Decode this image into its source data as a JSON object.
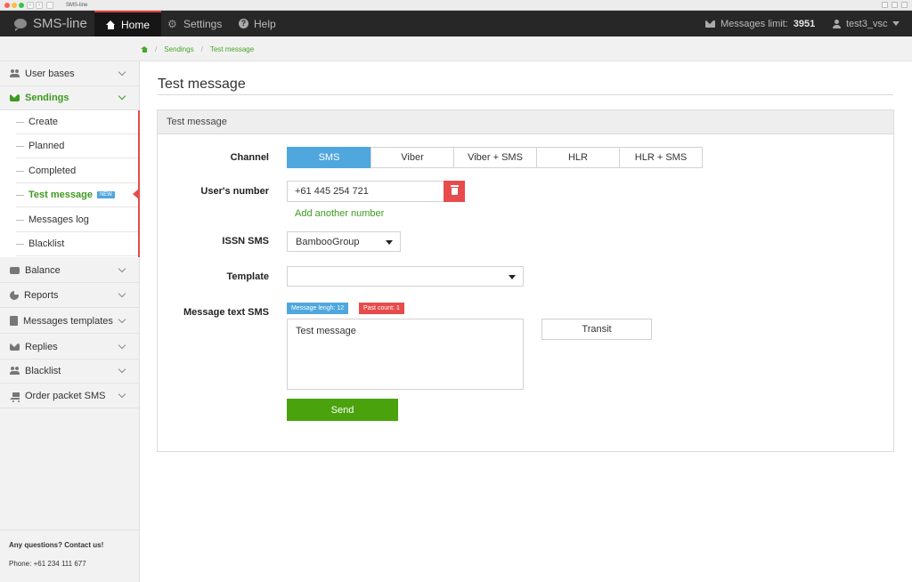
{
  "browser": {
    "tab_title": "SMS-line"
  },
  "topnav": {
    "brand": "SMS-line",
    "items": [
      {
        "label": "Home",
        "icon": "home-icon",
        "active": true
      },
      {
        "label": "Settings",
        "icon": "gear-icon"
      },
      {
        "label": "Help",
        "icon": "help-icon"
      }
    ],
    "limit_label": "Messages limit:",
    "limit_value": "3951",
    "user": "test3_vsc"
  },
  "breadcrumb": [
    "Sendings",
    "Test message"
  ],
  "sidebar": {
    "items": [
      {
        "label": "User bases",
        "icon": "users-icon"
      },
      {
        "label": "Sendings",
        "icon": "envelope-icon",
        "open": true
      },
      {
        "label": "Balance",
        "icon": "wallet-icon"
      },
      {
        "label": "Reports",
        "icon": "pie-chart-icon"
      },
      {
        "label": "Messages templates",
        "icon": "document-icon"
      },
      {
        "label": "Replies",
        "icon": "envelope-icon"
      },
      {
        "label": "Blacklist",
        "icon": "users-icon"
      },
      {
        "label": "Order packet SMS",
        "icon": "cart-icon"
      }
    ],
    "sub_items": [
      {
        "label": "Create"
      },
      {
        "label": "Planned"
      },
      {
        "label": "Completed"
      },
      {
        "label": "Test message",
        "active": true,
        "badge": "NEW"
      },
      {
        "label": "Messages log"
      },
      {
        "label": "Blacklist"
      }
    ],
    "contact": {
      "question": "Any questions? Contact us!",
      "phone": "Phone: +61 234 111 677"
    }
  },
  "main": {
    "title": "Test message",
    "panel_title": "Test message",
    "channel": {
      "label": "Channel",
      "options": [
        "SMS",
        "Viber",
        "Viber + SMS",
        "HLR",
        "HLR + SMS"
      ],
      "selected": "SMS"
    },
    "users_number": {
      "label": "User's number",
      "value": "+61 445 254 721",
      "add_link": "Add another number"
    },
    "issn": {
      "label": "ISSN SMS",
      "value": "BambooGroup"
    },
    "template": {
      "label": "Template",
      "value": ""
    },
    "message": {
      "label": "Message text SMS",
      "length_badge": "Message lengh: 12",
      "count_badge": "Past count: 1",
      "text": "Test message",
      "transit_label": "Transit"
    },
    "send_label": "Send"
  },
  "colors": {
    "accent_green": "#4aa20d",
    "accent_blue": "#4fa7dd",
    "accent_red": "#e84b4b",
    "nav_bg": "#272727"
  }
}
